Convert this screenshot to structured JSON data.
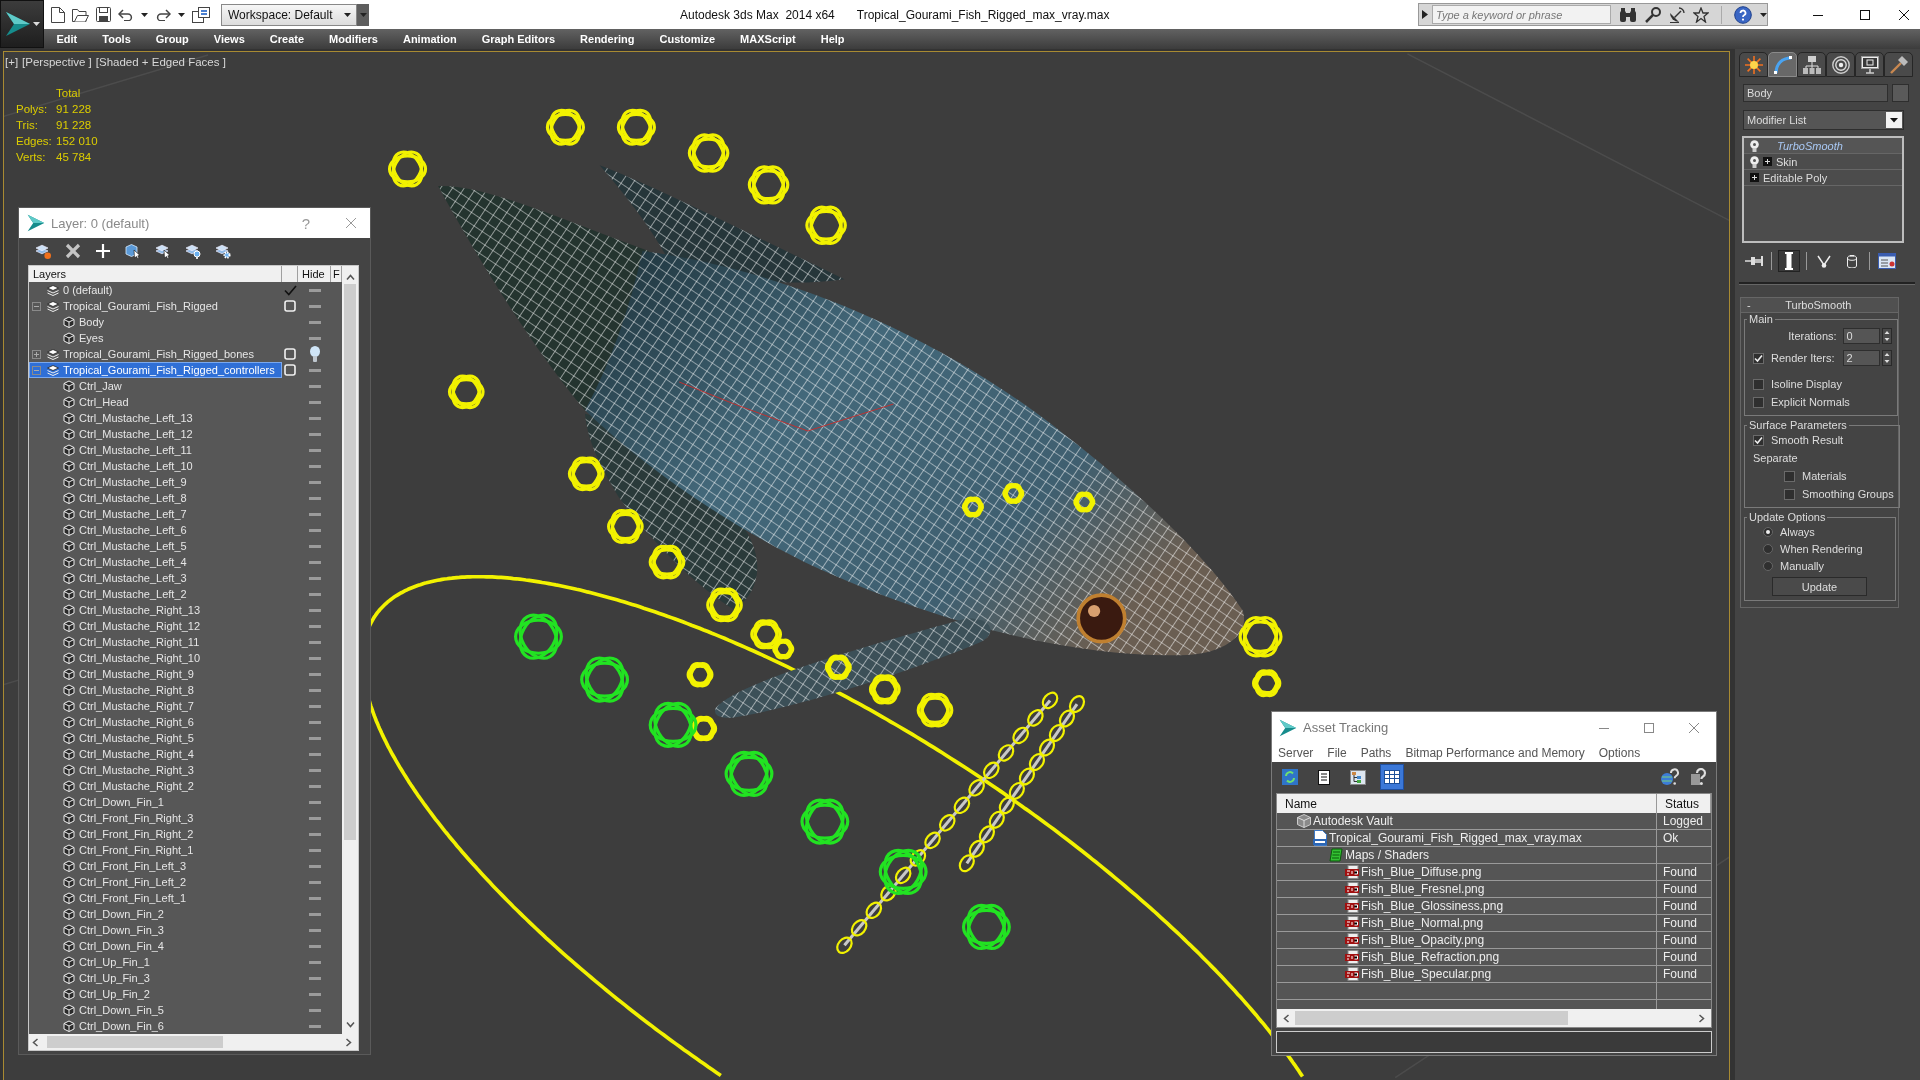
{
  "title_bar": {
    "workspace": "Workspace: Default",
    "app_title": "Autodesk 3ds Max  2014 x64",
    "file_name": "Tropical_Gourami_Fish_Rigged_max_vray.max",
    "search": {
      "placeholder": "Type a keyword or phrase"
    }
  },
  "menu_bar": [
    "Edit",
    "Tools",
    "Group",
    "Views",
    "Create",
    "Modifiers",
    "Animation",
    "Graph Editors",
    "Rendering",
    "Customize",
    "MAXScript",
    "Help"
  ],
  "viewport": {
    "labels": [
      "[+]",
      "[Perspective ]",
      "[Shaded + Edged Faces ]"
    ],
    "stats": {
      "header": "Total",
      "rows": [
        {
          "label": "Polys:",
          "value": "91 228"
        },
        {
          "label": "Tris:",
          "value": "91 228"
        },
        {
          "label": "Edges:",
          "value": "152 010"
        },
        {
          "label": "Verts:",
          "value": "45 784"
        }
      ]
    }
  },
  "layer_window": {
    "title": "Layer: 0 (default)",
    "help": "?",
    "columns": [
      "Layers",
      "Hide",
      "F"
    ],
    "tree": [
      {
        "name": "0 (default)",
        "kind": "layer",
        "current": true,
        "bulb": false,
        "selected": false
      },
      {
        "name": "Tropical_Gourami_Fish_Rigged",
        "kind": "layer",
        "current": false,
        "expanded": true,
        "bulb": false,
        "selected": false,
        "children": [
          {
            "name": "Body",
            "kind": "object",
            "bulb": false,
            "selected": false
          },
          {
            "name": "Eyes",
            "kind": "object",
            "bulb": false,
            "selected": false
          }
        ]
      },
      {
        "name": "Tropical_Gourami_Fish_Rigged_bones",
        "kind": "layer",
        "current": false,
        "expanded": false,
        "bulb": true,
        "selected": false
      },
      {
        "name": "Tropical_Gourami_Fish_Rigged_controllers",
        "kind": "layer",
        "current": false,
        "expanded": true,
        "bulb": false,
        "selected": true,
        "children": [
          {
            "name": "Ctrl_Jaw",
            "kind": "object",
            "bulb": false,
            "selected": false
          },
          {
            "name": "Ctrl_Head",
            "kind": "object",
            "bulb": false,
            "selected": false
          },
          {
            "name": "Ctrl_Mustache_Left_13",
            "kind": "object",
            "bulb": false,
            "selected": false
          },
          {
            "name": "Ctrl_Mustache_Left_12",
            "kind": "object",
            "bulb": false,
            "selected": false
          },
          {
            "name": "Ctrl_Mustache_Left_11",
            "kind": "object",
            "bulb": false,
            "selected": false
          },
          {
            "name": "Ctrl_Mustache_Left_10",
            "kind": "object",
            "bulb": false,
            "selected": false
          },
          {
            "name": "Ctrl_Mustache_Left_9",
            "kind": "object",
            "bulb": false,
            "selected": false
          },
          {
            "name": "Ctrl_Mustache_Left_8",
            "kind": "object",
            "bulb": false,
            "selected": false
          },
          {
            "name": "Ctrl_Mustache_Left_7",
            "kind": "object",
            "bulb": false,
            "selected": false
          },
          {
            "name": "Ctrl_Mustache_Left_6",
            "kind": "object",
            "bulb": false,
            "selected": false
          },
          {
            "name": "Ctrl_Mustache_Left_5",
            "kind": "object",
            "bulb": false,
            "selected": false
          },
          {
            "name": "Ctrl_Mustache_Left_4",
            "kind": "object",
            "bulb": false,
            "selected": false
          },
          {
            "name": "Ctrl_Mustache_Left_3",
            "kind": "object",
            "bulb": false,
            "selected": false
          },
          {
            "name": "Ctrl_Mustache_Left_2",
            "kind": "object",
            "bulb": false,
            "selected": false
          },
          {
            "name": "Ctrl_Mustache_Right_13",
            "kind": "object",
            "bulb": false,
            "selected": false
          },
          {
            "name": "Ctrl_Mustache_Right_12",
            "kind": "object",
            "bulb": false,
            "selected": false
          },
          {
            "name": "Ctrl_Mustache_Right_11",
            "kind": "object",
            "bulb": false,
            "selected": false
          },
          {
            "name": "Ctrl_Mustache_Right_10",
            "kind": "object",
            "bulb": false,
            "selected": false
          },
          {
            "name": "Ctrl_Mustache_Right_9",
            "kind": "object",
            "bulb": false,
            "selected": false
          },
          {
            "name": "Ctrl_Mustache_Right_8",
            "kind": "object",
            "bulb": false,
            "selected": false
          },
          {
            "name": "Ctrl_Mustache_Right_7",
            "kind": "object",
            "bulb": false,
            "selected": false
          },
          {
            "name": "Ctrl_Mustache_Right_6",
            "kind": "object",
            "bulb": false,
            "selected": false
          },
          {
            "name": "Ctrl_Mustache_Right_5",
            "kind": "object",
            "bulb": false,
            "selected": false
          },
          {
            "name": "Ctrl_Mustache_Right_4",
            "kind": "object",
            "bulb": false,
            "selected": false
          },
          {
            "name": "Ctrl_Mustache_Right_3",
            "kind": "object",
            "bulb": false,
            "selected": false
          },
          {
            "name": "Ctrl_Mustache_Right_2",
            "kind": "object",
            "bulb": false,
            "selected": false
          },
          {
            "name": "Ctrl_Down_Fin_1",
            "kind": "object",
            "bulb": false,
            "selected": false
          },
          {
            "name": "Ctrl_Front_Fin_Right_3",
            "kind": "object",
            "bulb": false,
            "selected": false
          },
          {
            "name": "Ctrl_Front_Fin_Right_2",
            "kind": "object",
            "bulb": false,
            "selected": false
          },
          {
            "name": "Ctrl_Front_Fin_Right_1",
            "kind": "object",
            "bulb": false,
            "selected": false
          },
          {
            "name": "Ctrl_Front_Fin_Left_3",
            "kind": "object",
            "bulb": false,
            "selected": false
          },
          {
            "name": "Ctrl_Front_Fin_Left_2",
            "kind": "object",
            "bulb": false,
            "selected": false
          },
          {
            "name": "Ctrl_Front_Fin_Left_1",
            "kind": "object",
            "bulb": false,
            "selected": false
          },
          {
            "name": "Ctrl_Down_Fin_2",
            "kind": "object",
            "bulb": false,
            "selected": false
          },
          {
            "name": "Ctrl_Down_Fin_3",
            "kind": "object",
            "bulb": false,
            "selected": false
          },
          {
            "name": "Ctrl_Down_Fin_4",
            "kind": "object",
            "bulb": false,
            "selected": false
          },
          {
            "name": "Ctrl_Up_Fin_1",
            "kind": "object",
            "bulb": false,
            "selected": false
          },
          {
            "name": "Ctrl_Up_Fin_3",
            "kind": "object",
            "bulb": false,
            "selected": false
          },
          {
            "name": "Ctrl_Up_Fin_2",
            "kind": "object",
            "bulb": false,
            "selected": false
          },
          {
            "name": "Ctrl_Down_Fin_5",
            "kind": "object",
            "bulb": false,
            "selected": false
          },
          {
            "name": "Ctrl_Down_Fin_6",
            "kind": "object",
            "bulb": false,
            "selected": false
          }
        ]
      }
    ]
  },
  "asset_tracking": {
    "title": "Asset Tracking",
    "menu": [
      "Server",
      "File",
      "Paths",
      "Bitmap Performance and Memory",
      "Options"
    ],
    "toolbar": [
      {
        "kind": "refresh",
        "on": false
      },
      {
        "kind": "list",
        "on": false
      },
      {
        "kind": "tree",
        "on": false
      },
      {
        "kind": "table",
        "on": true
      }
    ],
    "columns": [
      "Name",
      "Status"
    ],
    "tree": [
      {
        "name": "Autodesk Vault",
        "kind": "vault",
        "status": "Logged",
        "selected": false,
        "children": [
          {
            "name": "Tropical_Gourami_Fish_Rigged_max_vray.max",
            "kind": "max",
            "status": "Ok",
            "selected": false,
            "children": [
              {
                "name": "Maps / Shaders",
                "kind": "maps",
                "selected": false,
                "children": [
                  {
                    "name": "Fish_Blue_Diffuse.png",
                    "kind": "png",
                    "status": "Found",
                    "selected": false
                  },
                  {
                    "name": "Fish_Blue_Fresnel.png",
                    "kind": "png",
                    "status": "Found",
                    "selected": false
                  },
                  {
                    "name": "Fish_Blue_Glossiness.png",
                    "kind": "png",
                    "status": "Found",
                    "selected": false
                  },
                  {
                    "name": "Fish_Blue_Normal.png",
                    "kind": "png",
                    "status": "Found",
                    "selected": false
                  },
                  {
                    "name": "Fish_Blue_Opacity.png",
                    "kind": "png",
                    "status": "Found",
                    "selected": false
                  },
                  {
                    "name": "Fish_Blue_Refraction.png",
                    "kind": "png",
                    "status": "Found",
                    "selected": false
                  },
                  {
                    "name": "Fish_Blue_Specular.png",
                    "kind": "png",
                    "status": "Found",
                    "selected": false
                  }
                ]
              }
            ]
          }
        ]
      }
    ]
  },
  "command_panel": {
    "tabs": [
      {
        "kind": "create",
        "selected": false
      },
      {
        "kind": "modify",
        "selected": true
      },
      {
        "kind": "hierarchy",
        "selected": false
      },
      {
        "kind": "motion",
        "selected": false
      },
      {
        "kind": "display",
        "selected": false
      },
      {
        "kind": "utilities",
        "selected": false
      }
    ],
    "object_name": "Body",
    "modifier_list": "Modifier List",
    "stack": [
      {
        "name": "TurboSmooth",
        "enabled": true,
        "instanced": true,
        "selected": true
      },
      {
        "name": "Skin",
        "enabled": true,
        "expanded": false,
        "instanced": false,
        "selected": false
      },
      {
        "name": "Editable Poly",
        "expanded": false,
        "instanced": false,
        "selected": false
      }
    ],
    "stack_tools": [
      {
        "kind": "pin",
        "on": false
      },
      {
        "kind": "end_result",
        "on": true
      },
      {
        "kind": "make_unique",
        "on": false
      },
      {
        "kind": "remove",
        "on": false
      },
      {
        "kind": "configure",
        "on": false
      }
    ],
    "rollout": {
      "sign": "-",
      "title": "TurboSmooth",
      "groups": [
        {
          "title": "Main",
          "controls": [
            {
              "kind": "spinner",
              "label": "Iterations:",
              "value": "0"
            },
            {
              "kind": "check_spinner",
              "label": "Render Iters:",
              "checked": true,
              "value": "2"
            },
            {
              "kind": "checkbox",
              "label": "Isoline Display",
              "checked": false
            },
            {
              "kind": "checkbox",
              "label": "Explicit Normals",
              "checked": false
            }
          ]
        },
        {
          "title": "Surface Parameters",
          "controls": [
            {
              "kind": "checkbox",
              "label": "Smooth Result",
              "checked": true
            },
            {
              "kind": "label",
              "label": "Separate",
              "children": [
                {
                  "kind": "checkbox",
                  "label": "Materials",
                  "checked": false
                },
                {
                  "kind": "checkbox",
                  "label": "Smoothing Groups",
                  "checked": false
                }
              ]
            }
          ]
        },
        {
          "title": "Update Options",
          "controls": [
            {
              "kind": "radio",
              "label": "Always",
              "selected": true
            },
            {
              "kind": "radio",
              "label": "When Rendering",
              "selected": false
            },
            {
              "kind": "radio",
              "label": "Manually",
              "selected": false
            },
            {
              "kind": "button",
              "label": "Update"
            }
          ]
        }
      ]
    }
  }
}
